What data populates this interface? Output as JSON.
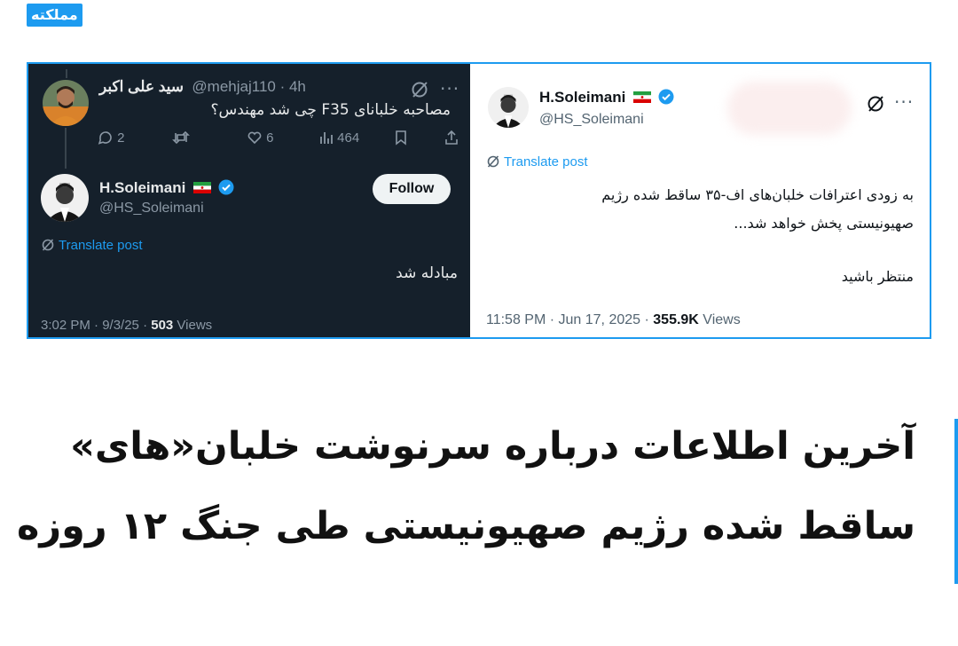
{
  "brand": {
    "label": "مملکته"
  },
  "dark_post": {
    "reply_to": {
      "display_name": "سید علی اکبر",
      "handle_time": "@mehjaj110 · 4h",
      "text": "مصاحبه خلبانای F35 چی شد مهندس؟",
      "replies": "2",
      "likes": "6",
      "views": "464"
    },
    "author": {
      "display_name": "H.Soleimani",
      "handle": "@HS_Soleimani"
    },
    "follow_label": "Follow",
    "translate_label": "Translate post",
    "text": "مبادله شد",
    "footer_time": "3:02 PM · 9/3/25 · ",
    "footer_views_count": "503",
    "footer_views_label": " Views"
  },
  "light_post": {
    "author": {
      "display_name": "H.Soleimani",
      "handle": "@HS_Soleimani"
    },
    "translate_label": "Translate post",
    "text_line1": "به زودی اعترافات خلبان‌های اف-۳۵ ساقط شده رژیم",
    "text_line2": "صهیونیستی پخش خواهد شد...",
    "text_line3": "منتظر باشید",
    "footer_time": "11:58 PM · Jun 17, 2025 · ",
    "footer_views_count": "355.9K",
    "footer_views_label": " Views"
  },
  "headline": {
    "line1": "آخرین اطلاعات درباره سرنوشت خلبان«های»",
    "line2": "ساقط شده رژیم صهیونیستی طی جنگ ۱۲ روزه"
  },
  "colors": {
    "accent": "#1d9bf0",
    "dark_bg": "#15202b",
    "verified": "#1d9bf0"
  }
}
